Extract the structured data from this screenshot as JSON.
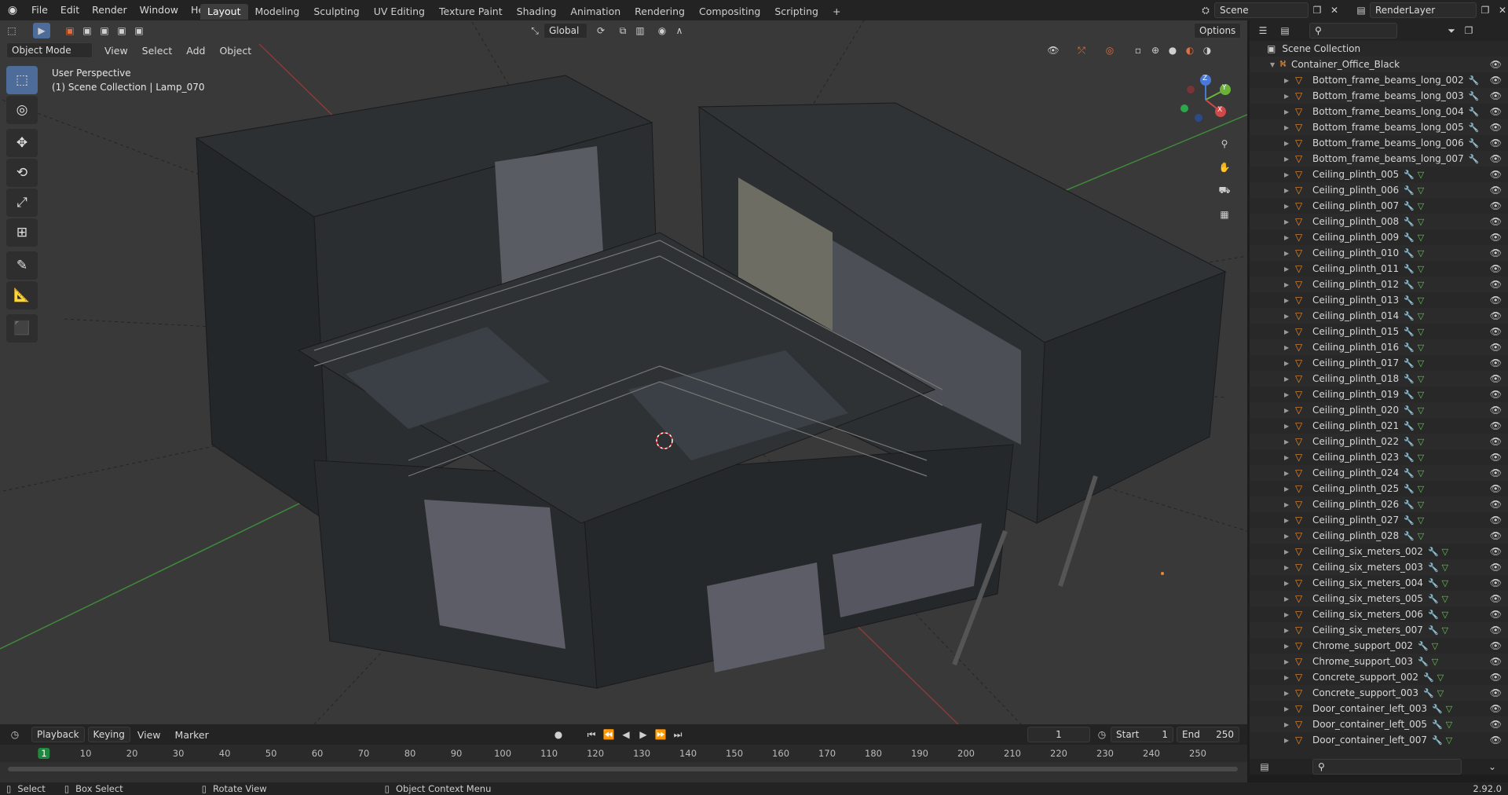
{
  "topbar": {
    "menus": [
      "File",
      "Edit",
      "Render",
      "Window",
      "Help"
    ],
    "workspaces": [
      "Layout",
      "Modeling",
      "Sculpting",
      "UV Editing",
      "Texture Paint",
      "Shading",
      "Animation",
      "Rendering",
      "Compositing",
      "Scripting"
    ],
    "active_workspace": "Layout",
    "add_tab": "+",
    "scene": "Scene",
    "render_layer": "RenderLayer"
  },
  "viewport_header": {
    "mode": "Object Mode",
    "menus": [
      "View",
      "Select",
      "Add",
      "Object"
    ],
    "transform_orientation": "Global",
    "options": "Options"
  },
  "viewport": {
    "perspective_label": "User Perspective",
    "context_label": "(1) Scene Collection | Lamp_070",
    "gizmo": {
      "x": "X",
      "y": "Y",
      "z": "Z"
    }
  },
  "toolbar": {
    "tools": [
      "select-box",
      "cursor",
      "move",
      "rotate",
      "scale",
      "transform",
      "annotate",
      "measure",
      "add-cube"
    ]
  },
  "outliner": {
    "root": "Scene Collection",
    "collection": "Container_Office_Black",
    "items": [
      "Bottom_frame_beams_long_002",
      "Bottom_frame_beams_long_003",
      "Bottom_frame_beams_long_004",
      "Bottom_frame_beams_long_005",
      "Bottom_frame_beams_long_006",
      "Bottom_frame_beams_long_007",
      "Ceiling_plinth_005",
      "Ceiling_plinth_006",
      "Ceiling_plinth_007",
      "Ceiling_plinth_008",
      "Ceiling_plinth_009",
      "Ceiling_plinth_010",
      "Ceiling_plinth_011",
      "Ceiling_plinth_012",
      "Ceiling_plinth_013",
      "Ceiling_plinth_014",
      "Ceiling_plinth_015",
      "Ceiling_plinth_016",
      "Ceiling_plinth_017",
      "Ceiling_plinth_018",
      "Ceiling_plinth_019",
      "Ceiling_plinth_020",
      "Ceiling_plinth_021",
      "Ceiling_plinth_022",
      "Ceiling_plinth_023",
      "Ceiling_plinth_024",
      "Ceiling_plinth_025",
      "Ceiling_plinth_026",
      "Ceiling_plinth_027",
      "Ceiling_plinth_028",
      "Ceiling_six_meters_002",
      "Ceiling_six_meters_003",
      "Ceiling_six_meters_004",
      "Ceiling_six_meters_005",
      "Ceiling_six_meters_006",
      "Ceiling_six_meters_007",
      "Chrome_support_002",
      "Chrome_support_003",
      "Concrete_support_002",
      "Concrete_support_003",
      "Door_container_left_003",
      "Door_container_left_005",
      "Door_container_left_007"
    ]
  },
  "timeline": {
    "menus": [
      "Playback",
      "Keying",
      "View",
      "Marker"
    ],
    "current_frame": "1",
    "start_label": "Start",
    "start": "1",
    "end_label": "End",
    "end": "250",
    "ticks": [
      "1",
      "10",
      "20",
      "30",
      "40",
      "50",
      "60",
      "70",
      "80",
      "90",
      "100",
      "110",
      "120",
      "130",
      "140",
      "150",
      "160",
      "170",
      "180",
      "190",
      "200",
      "210",
      "220",
      "230",
      "240",
      "250"
    ]
  },
  "statusbar": {
    "select": "Select",
    "box_select": "Box Select",
    "rotate_view": "Rotate View",
    "context_menu": "Object Context Menu",
    "version": "2.92.0"
  },
  "colors": {
    "accent": "#4d6c99",
    "mesh_icon": "#e8892e",
    "frame_marker": "#1f8a3e"
  }
}
